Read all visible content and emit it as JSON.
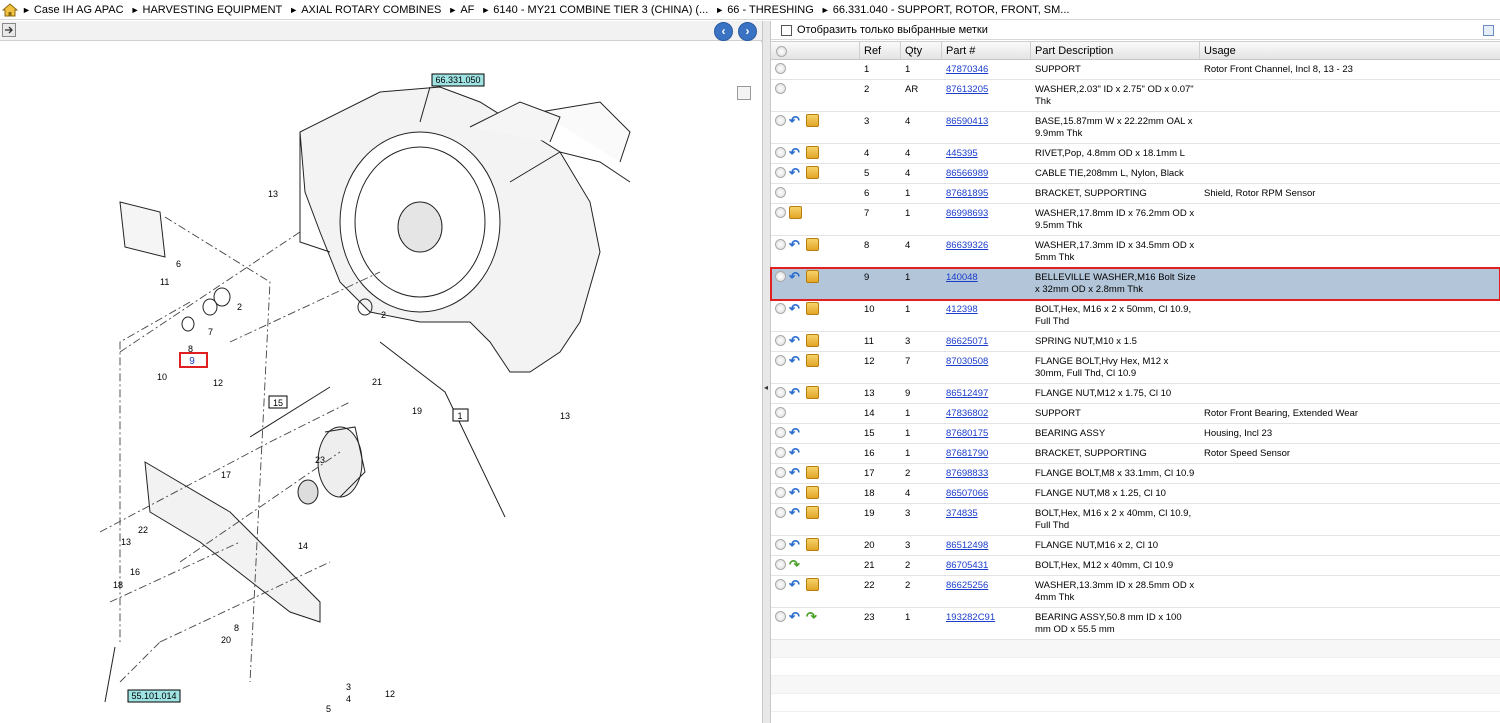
{
  "breadcrumb": [
    "Case IH AG APAC",
    "HARVESTING EQUIPMENT",
    "AXIAL ROTARY COMBINES",
    "AF",
    "6140 - MY21 COMBINE TIER 3 (CHINA) (...",
    "66 - THRESHING",
    "66.331.040 - SUPPORT, ROTOR, FRONT, SM..."
  ],
  "filter": {
    "label": "Отобразить только выбранные метки"
  },
  "diagram": {
    "ref_top": "66.331.050",
    "ref_bottom": "55.101.014",
    "callouts": [
      "13",
      "6",
      "11",
      "2",
      "7",
      "8",
      "9",
      "10",
      "12",
      "2",
      "21",
      "15",
      "1",
      "19",
      "13",
      "23",
      "17",
      "22",
      "13",
      "16",
      "18",
      "14",
      "8",
      "20",
      "3",
      "4",
      "5",
      "12"
    ]
  },
  "table": {
    "headers": [
      "Ref",
      "Qty",
      "Part #",
      "Part Description",
      "Usage"
    ],
    "rows": [
      {
        "ref": "1",
        "qty": "1",
        "part": "47870346",
        "desc": "SUPPORT",
        "usage": "Rotor Front Channel, Incl 8, 13 - 23",
        "icons": []
      },
      {
        "ref": "2",
        "qty": "AR",
        "part": "87613205",
        "desc": "WASHER,2.03\" ID x 2.75\" OD x 0.07\" Thk",
        "usage": "",
        "icons": []
      },
      {
        "ref": "3",
        "qty": "4",
        "part": "86590413",
        "desc": "BASE,15.87mm W x 22.22mm OAL x 9.9mm Thk",
        "usage": "",
        "icons": [
          "undo",
          "box"
        ]
      },
      {
        "ref": "4",
        "qty": "4",
        "part": "445395",
        "desc": "RIVET,Pop, 4.8mm OD x 18.1mm L",
        "usage": "",
        "icons": [
          "undo",
          "box"
        ]
      },
      {
        "ref": "5",
        "qty": "4",
        "part": "86566989",
        "desc": "CABLE TIE,208mm L, Nylon, Black",
        "usage": "",
        "icons": [
          "undo",
          "box"
        ]
      },
      {
        "ref": "6",
        "qty": "1",
        "part": "87681895",
        "desc": "BRACKET, SUPPORTING",
        "usage": "Shield, Rotor RPM Sensor",
        "icons": []
      },
      {
        "ref": "7",
        "qty": "1",
        "part": "86998693",
        "desc": "WASHER,17.8mm ID x 76.2mm OD x 9.5mm Thk",
        "usage": "",
        "icons": [
          "box"
        ]
      },
      {
        "ref": "8",
        "qty": "4",
        "part": "86639326",
        "desc": "WASHER,17.3mm ID x 34.5mm OD x 5mm Thk",
        "usage": "",
        "icons": [
          "undo",
          "box"
        ]
      },
      {
        "ref": "9",
        "qty": "1",
        "part": "140048",
        "desc": "BELLEVILLE WASHER,M16 Bolt Size x 32mm OD x 2.8mm Thk",
        "usage": "",
        "icons": [
          "undo",
          "box"
        ],
        "selected": true
      },
      {
        "ref": "10",
        "qty": "1",
        "part": "412398",
        "desc": "BOLT,Hex, M16 x 2 x 50mm, Cl 10.9, Full Thd",
        "usage": "",
        "icons": [
          "undo",
          "box"
        ]
      },
      {
        "ref": "11",
        "qty": "3",
        "part": "86625071",
        "desc": "SPRING NUT,M10 x 1.5",
        "usage": "",
        "icons": [
          "undo",
          "box"
        ]
      },
      {
        "ref": "12",
        "qty": "7",
        "part": "87030508",
        "desc": "FLANGE BOLT,Hvy Hex, M12 x 30mm, Full Thd, Cl 10.9",
        "usage": "",
        "icons": [
          "undo",
          "box"
        ]
      },
      {
        "ref": "13",
        "qty": "9",
        "part": "86512497",
        "desc": "FLANGE NUT,M12 x 1.75, Cl 10",
        "usage": "",
        "icons": [
          "undo",
          "box"
        ]
      },
      {
        "ref": "14",
        "qty": "1",
        "part": "47836802",
        "desc": "SUPPORT",
        "usage": "Rotor Front Bearing, Extended Wear",
        "icons": []
      },
      {
        "ref": "15",
        "qty": "1",
        "part": "87680175",
        "desc": "BEARING ASSY",
        "usage": "Housing, Incl 23",
        "icons": [
          "undo"
        ]
      },
      {
        "ref": "16",
        "qty": "1",
        "part": "87681790",
        "desc": "BRACKET, SUPPORTING",
        "usage": "Rotor Speed Sensor",
        "icons": [
          "undo"
        ]
      },
      {
        "ref": "17",
        "qty": "2",
        "part": "87698833",
        "desc": "FLANGE BOLT,M8 x 33.1mm, Cl 10.9",
        "usage": "",
        "icons": [
          "undo",
          "box"
        ]
      },
      {
        "ref": "18",
        "qty": "4",
        "part": "86507066",
        "desc": "FLANGE NUT,M8 x 1.25, Cl 10",
        "usage": "",
        "icons": [
          "undo",
          "box"
        ]
      },
      {
        "ref": "19",
        "qty": "3",
        "part": "374835",
        "desc": "BOLT,Hex, M16 x 2 x 40mm, Cl 10.9, Full Thd",
        "usage": "",
        "icons": [
          "undo",
          "box"
        ]
      },
      {
        "ref": "20",
        "qty": "3",
        "part": "86512498",
        "desc": "FLANGE NUT,M16 x 2, Cl 10",
        "usage": "",
        "icons": [
          "undo",
          "box"
        ]
      },
      {
        "ref": "21",
        "qty": "2",
        "part": "86705431",
        "desc": "BOLT,Hex, M12 x 40mm, Cl 10.9",
        "usage": "",
        "icons": [
          "redo"
        ]
      },
      {
        "ref": "22",
        "qty": "2",
        "part": "86625256",
        "desc": "WASHER,13.3mm ID x 28.5mm OD x 4mm Thk",
        "usage": "",
        "icons": [
          "undo",
          "box"
        ]
      },
      {
        "ref": "23",
        "qty": "1",
        "part": "193282C91",
        "desc": "BEARING ASSY,50.8 mm ID x 100 mm OD x 55.5 mm",
        "usage": "",
        "icons": [
          "undo",
          "redo"
        ]
      }
    ]
  }
}
